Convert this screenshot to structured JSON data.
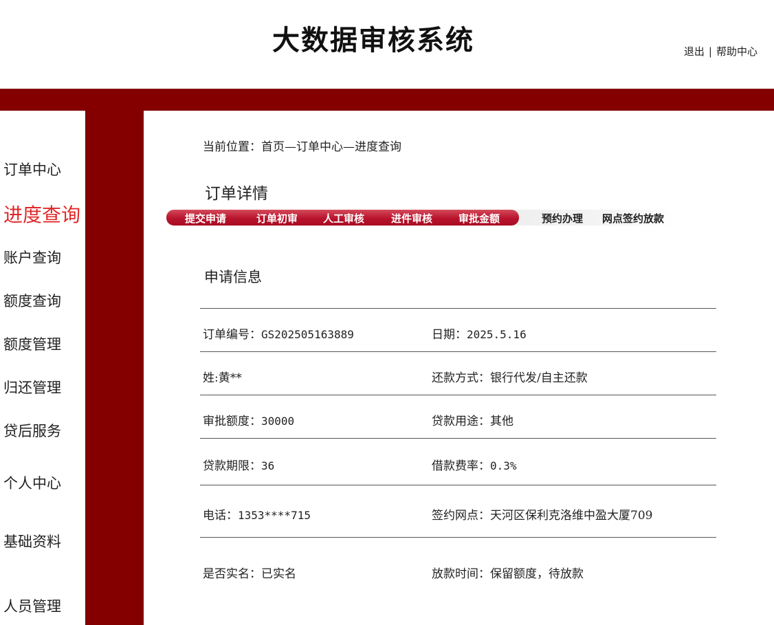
{
  "header": {
    "title": "大数据审核系统",
    "logout": "退出",
    "separator": "|",
    "help": "帮助中心"
  },
  "sidebar": {
    "items": [
      {
        "label": "订单中心",
        "active": false
      },
      {
        "label": "进度查询",
        "active": true
      },
      {
        "label": "账户查询",
        "active": false
      },
      {
        "label": "额度查询",
        "active": false
      },
      {
        "label": "额度管理",
        "active": false
      },
      {
        "label": "归还管理",
        "active": false
      },
      {
        "label": "贷后服务",
        "active": false
      },
      {
        "label": "个人中心",
        "active": false
      },
      {
        "label": "基础资料",
        "active": false
      },
      {
        "label": "人员管理",
        "active": false
      }
    ]
  },
  "breadcrumb": {
    "prefix": "当前位置：",
    "home": "首页",
    "sep": "—",
    "level1": "订单中心",
    "level2": "进度查询"
  },
  "order_title": "订单详情",
  "progress": {
    "steps": [
      {
        "label": "提交申请",
        "done": true
      },
      {
        "label": "订单初审",
        "done": true
      },
      {
        "label": "人工审核",
        "done": true
      },
      {
        "label": "进件审核",
        "done": true
      },
      {
        "label": "审批金额",
        "done": true
      },
      {
        "label": "预约办理",
        "done": false
      },
      {
        "label": "网点签约放款",
        "done": false
      }
    ],
    "accent_color": "#b8142d"
  },
  "application": {
    "title": "申请信息",
    "rows": [
      {
        "left": {
          "label": "订单编号：",
          "value": "GS202505163889"
        },
        "right": {
          "label": "日期：",
          "value": "2025.5.16"
        }
      },
      {
        "left": {
          "label": "姓:",
          "value": "黄**"
        },
        "right": {
          "label": "还款方式：",
          "value": "银行代发/自主还款"
        }
      },
      {
        "left": {
          "label": "审批额度：",
          "value": "30000"
        },
        "right": {
          "label": "贷款用途：",
          "value": "其他"
        }
      },
      {
        "left": {
          "label": "贷款期限：",
          "value": "36"
        },
        "right": {
          "label": "借款费率：",
          "value": "0.3%"
        }
      },
      {
        "left": {
          "label": "电话：",
          "value": "1353****715"
        },
        "right": {
          "label": "签约网点：",
          "value": "天河区保利克洛维中盈大厦709"
        }
      },
      {
        "left": {
          "label": "是否实名：",
          "value": "已实名"
        },
        "right": {
          "label": "放款时间：",
          "value": "保留额度，待放款"
        }
      }
    ]
  },
  "colors": {
    "brand_dark_red": "#840000",
    "active_menu_red": "#e0282a"
  }
}
